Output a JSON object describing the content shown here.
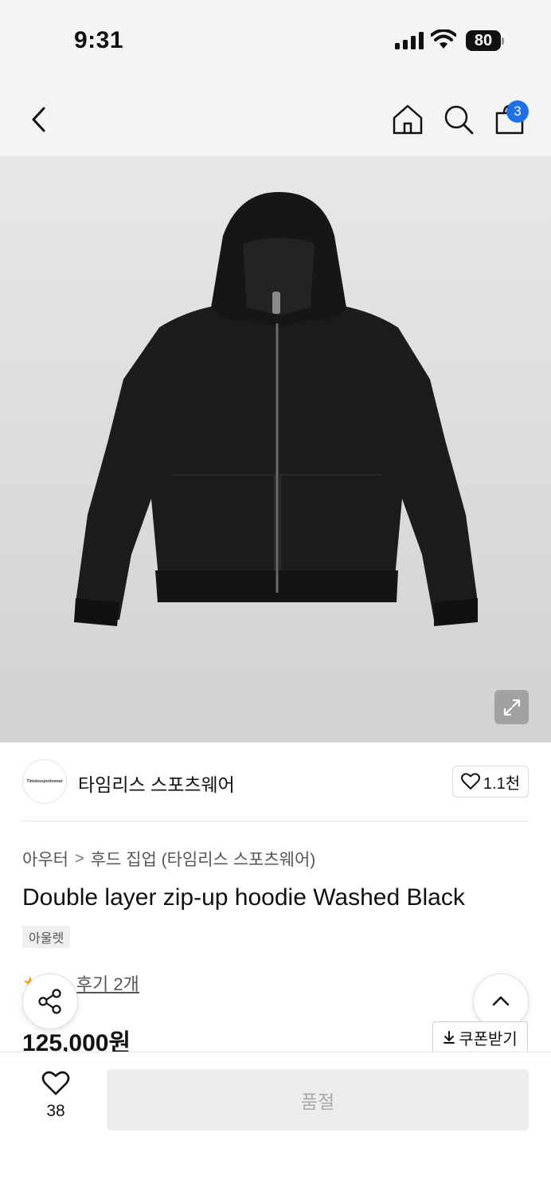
{
  "status_bar": {
    "time": "9:31",
    "battery": "80"
  },
  "nav": {
    "cart_count": "3"
  },
  "brand": {
    "logo_text": "Timelessportswear",
    "name": "타임리스 스포츠웨어",
    "likes": "1.1천"
  },
  "breadcrumb": {
    "category": "아우터",
    "separator": ">",
    "subcategory": "후드 집업 (타임리스 스포츠웨어)"
  },
  "product": {
    "title": "Double layer zip-up hoodie Washed Black",
    "tag": "아울렛",
    "review_text": "후기 2개",
    "price": "125,000원"
  },
  "coupon": {
    "label": "쿠폰받기"
  },
  "bottom": {
    "wish_count": "38",
    "buy_label": "품절"
  },
  "colors": {
    "accent_blue": "#1f6fe6",
    "star": "#f5a623",
    "disabled_text": "#a9a9a9"
  }
}
